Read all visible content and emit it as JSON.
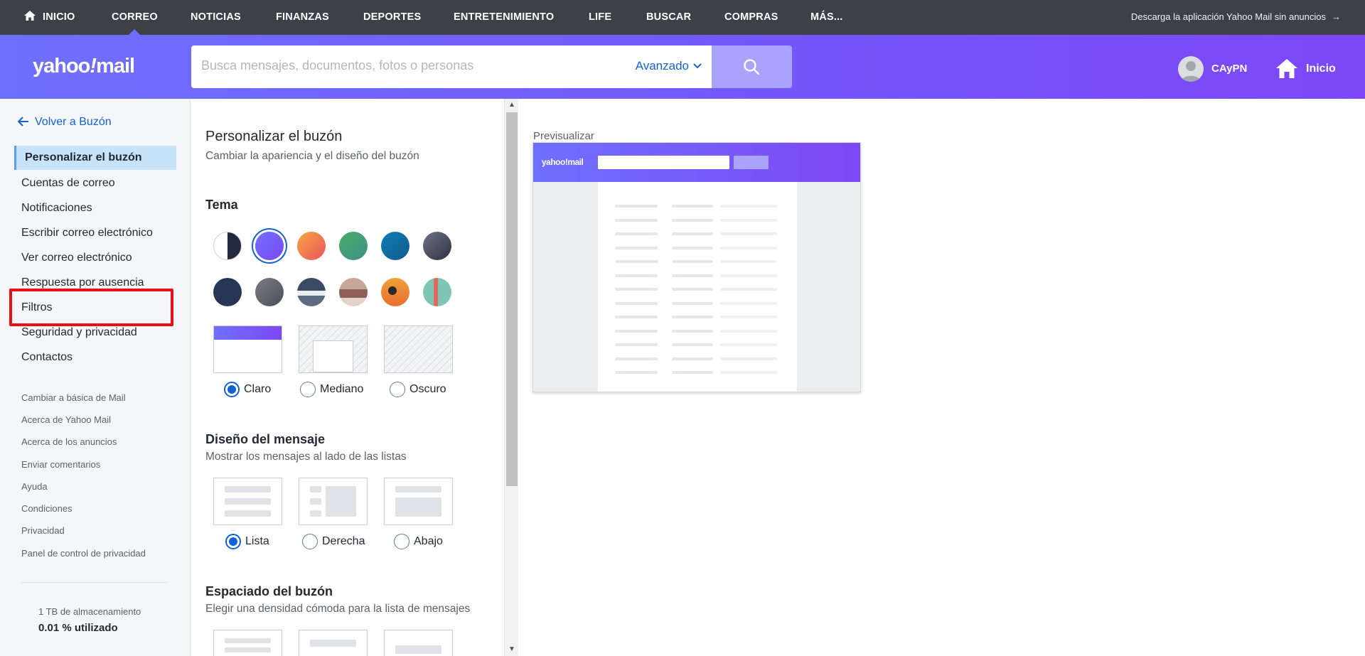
{
  "topnav": {
    "items": [
      "INICIO",
      "CORREO",
      "NOTICIAS",
      "FINANZAS",
      "DEPORTES",
      "ENTRETENIMIENTO",
      "LIFE",
      "BUSCAR",
      "COMPRAS",
      "MÁS..."
    ],
    "active": "CORREO",
    "download_text": "Descarga la aplicación Yahoo Mail sin anuncios",
    "download_arrow": "→"
  },
  "header": {
    "logo": {
      "part1": "yahoo",
      "bang": "!",
      "part2": "mail"
    },
    "search_placeholder": "Busca mensajes, documentos, fotos o personas",
    "advanced_label": "Avanzado",
    "user_name": "CAyPN",
    "home_label": "Inicio"
  },
  "sidebar": {
    "back_label": "Volver a Buzón",
    "menu": [
      "Personalizar el buzón",
      "Cuentas de correo",
      "Notificaciones",
      "Escribir correo electrónico",
      "Ver correo electrónico",
      "Respuesta por ausencia",
      "Filtros",
      "Seguridad y privacidad",
      "Contactos"
    ],
    "selected": "Personalizar el buzón",
    "highlighted": "Filtros",
    "secondary": [
      "Cambiar a básica de Mail",
      "Acerca de Yahoo Mail",
      "Acerca de los anuncios",
      "Enviar comentarios",
      "Ayuda",
      "Condiciones",
      "Privacidad",
      "Panel de control de privacidad"
    ],
    "storage_total": "1 TB de almacenamiento",
    "storage_used": "0.01 % utilizado"
  },
  "panel": {
    "title": "Personalizar el buzón",
    "subtitle": "Cambiar la apariencia y el diseño del buzón",
    "theme_title": "Tema",
    "brightness_options": [
      "Claro",
      "Mediano",
      "Oscuro"
    ],
    "brightness_selected": "Claro",
    "layout_title": "Diseño del mensaje",
    "layout_subtitle": "Mostrar los mensajes al lado de las listas",
    "layout_options": [
      "Lista",
      "Derecha",
      "Abajo"
    ],
    "layout_selected": "Lista",
    "spacing_title": "Espaciado del buzón",
    "spacing_subtitle": "Elegir una densidad cómoda para la lista de mensajes"
  },
  "preview": {
    "label": "Previsualizar",
    "logo": "yahoo!mail"
  },
  "colors": {
    "accent": "#1262d3",
    "brand_purple": "#7455fb",
    "highlight_box": "#e60f14",
    "selected_menu_bg": "#c7e3fa"
  }
}
